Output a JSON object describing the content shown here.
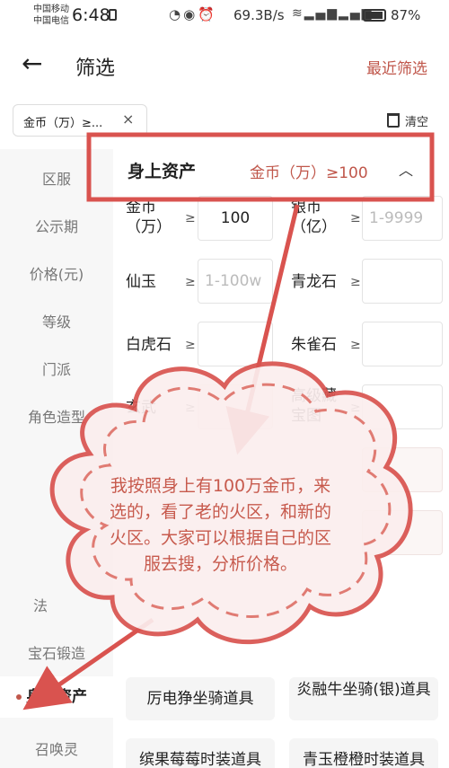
{
  "status_bar": {
    "carrier_1": "中国移动",
    "carrier_2": "中国电信",
    "time": "6:48",
    "net_speed": "69.3B/s",
    "battery": "87%",
    "icons": [
      "sim-icon",
      "speed-dial-icon",
      "eye-icon",
      "alarm-icon",
      "wifi-icon",
      "signal-4g-icon",
      "signal-4g-icon",
      "battery-icon"
    ]
  },
  "header": {
    "back_icon": "back-arrow-icon",
    "title": "筛选",
    "recent_label": "最近筛选"
  },
  "chip_bar": {
    "chip_label": "金币（万）≥...",
    "chip_close": "×",
    "clear_label": "清空"
  },
  "sidebar": {
    "items": [
      {
        "label": "区服"
      },
      {
        "label": "公示期"
      },
      {
        "label": "价格(元)"
      },
      {
        "label": "等级"
      },
      {
        "label": "门派"
      },
      {
        "label": "角色造型"
      },
      {
        "label": "法"
      },
      {
        "label": "宝石锻造"
      },
      {
        "label": "身上资产"
      },
      {
        "label": "召唤灵"
      }
    ],
    "active_index": 8
  },
  "section": {
    "title": "身上资产",
    "summary": "金币（万）≥100",
    "caret": "^"
  },
  "fields": [
    {
      "label": "金币\n（万）",
      "op": "≥",
      "value": "100",
      "placeholder": ""
    },
    {
      "label": "银币\n（亿）",
      "op": "≥",
      "value": "",
      "placeholder": "1-9999"
    },
    {
      "label": "仙玉",
      "op": "≥",
      "value": "",
      "placeholder": "1-100w"
    },
    {
      "label": "青龙石",
      "op": "≥",
      "value": "",
      "placeholder": ""
    },
    {
      "label": "白虎石",
      "op": "≥",
      "value": "",
      "placeholder": ""
    },
    {
      "label": "朱雀石",
      "op": "≥",
      "value": "",
      "placeholder": ""
    },
    {
      "label": "玄武",
      "op": "≥",
      "value": "",
      "placeholder": ""
    },
    {
      "label": "高级藏\n宝图",
      "op": "≥",
      "value": "",
      "placeholder": ""
    }
  ],
  "options": [
    {
      "label": "厉电狰坐骑道具"
    },
    {
      "label": "炎融牛坐骑(银)道具"
    },
    {
      "label": "缤果莓莓时装道具"
    },
    {
      "label": "青玉橙橙时装道具"
    }
  ],
  "annotation": {
    "text": "我按照身上有100万金币，来选的，看了老的火区，和新的火区。大家可以根据自己的区服去搜，分析价格。",
    "color": "#c75a4d"
  },
  "colors": {
    "accent": "#c0574b",
    "annotation": "#d9534f"
  }
}
